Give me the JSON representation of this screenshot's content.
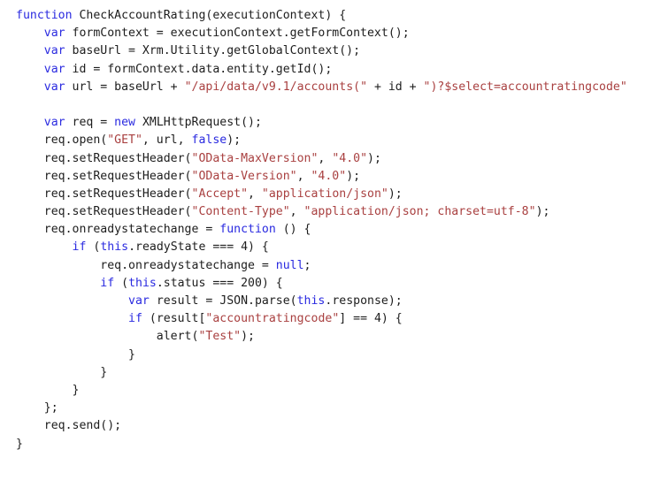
{
  "editor": {
    "language": "javascript",
    "background_color": "#ffffff",
    "default_text_color": "#1d1d1d",
    "keyword_color": "#2a2ae0",
    "string_color": "#a94040",
    "font_size_px": 13.2,
    "line_height_px": 20.2
  },
  "code": {
    "lines": [
      {
        "index": 1,
        "indent": 0,
        "text": "function CheckAccountRating(executionContext) {",
        "tokens": [
          {
            "t": "function",
            "c": "tok-keyword"
          },
          {
            "t": " CheckAccountRating(executionContext) {",
            "c": "tok-plain"
          }
        ]
      },
      {
        "index": 2,
        "indent": 4,
        "text": "    var formContext = executionContext.getFormContext();",
        "tokens": [
          {
            "t": "    ",
            "c": "tok-plain"
          },
          {
            "t": "var",
            "c": "tok-keyword"
          },
          {
            "t": " formContext = executionContext.getFormContext();",
            "c": "tok-plain"
          }
        ]
      },
      {
        "index": 3,
        "indent": 4,
        "text": "    var baseUrl = Xrm.Utility.getGlobalContext();",
        "tokens": [
          {
            "t": "    ",
            "c": "tok-plain"
          },
          {
            "t": "var",
            "c": "tok-keyword"
          },
          {
            "t": " baseUrl = Xrm.Utility.getGlobalContext();",
            "c": "tok-plain"
          }
        ]
      },
      {
        "index": 4,
        "indent": 4,
        "text": "    var id = formContext.data.entity.getId();",
        "tokens": [
          {
            "t": "    ",
            "c": "tok-plain"
          },
          {
            "t": "var",
            "c": "tok-keyword"
          },
          {
            "t": " id = formContext.data.entity.getId();",
            "c": "tok-plain"
          }
        ]
      },
      {
        "index": 5,
        "indent": 4,
        "text": "    var url = baseUrl + \"/api/data/v9.1/accounts(\" + id + \")?$select=accountratingcode\"",
        "tokens": [
          {
            "t": "    ",
            "c": "tok-plain"
          },
          {
            "t": "var",
            "c": "tok-keyword"
          },
          {
            "t": " url = baseUrl + ",
            "c": "tok-plain"
          },
          {
            "t": "\"/api/data/v9.1/accounts(\"",
            "c": "tok-string"
          },
          {
            "t": " + id + ",
            "c": "tok-plain"
          },
          {
            "t": "\")?$select=accountratingcode\"",
            "c": "tok-string"
          }
        ]
      },
      {
        "index": 6,
        "indent": 0,
        "text": "",
        "tokens": []
      },
      {
        "index": 7,
        "indent": 4,
        "text": "    var req = new XMLHttpRequest();",
        "tokens": [
          {
            "t": "    ",
            "c": "tok-plain"
          },
          {
            "t": "var",
            "c": "tok-keyword"
          },
          {
            "t": " req = ",
            "c": "tok-plain"
          },
          {
            "t": "new",
            "c": "tok-keyword"
          },
          {
            "t": " XMLHttpRequest();",
            "c": "tok-plain"
          }
        ]
      },
      {
        "index": 8,
        "indent": 4,
        "text": "    req.open(\"GET\", url, false);",
        "tokens": [
          {
            "t": "    req.open(",
            "c": "tok-plain"
          },
          {
            "t": "\"GET\"",
            "c": "tok-string"
          },
          {
            "t": ", url, ",
            "c": "tok-plain"
          },
          {
            "t": "false",
            "c": "tok-keyword"
          },
          {
            "t": ");",
            "c": "tok-plain"
          }
        ]
      },
      {
        "index": 9,
        "indent": 4,
        "text": "    req.setRequestHeader(\"OData-MaxVersion\", \"4.0\");",
        "tokens": [
          {
            "t": "    req.setRequestHeader(",
            "c": "tok-plain"
          },
          {
            "t": "\"OData-MaxVersion\"",
            "c": "tok-string"
          },
          {
            "t": ", ",
            "c": "tok-plain"
          },
          {
            "t": "\"4.0\"",
            "c": "tok-string"
          },
          {
            "t": ");",
            "c": "tok-plain"
          }
        ]
      },
      {
        "index": 10,
        "indent": 4,
        "text": "    req.setRequestHeader(\"OData-Version\", \"4.0\");",
        "tokens": [
          {
            "t": "    req.setRequestHeader(",
            "c": "tok-plain"
          },
          {
            "t": "\"OData-Version\"",
            "c": "tok-string"
          },
          {
            "t": ", ",
            "c": "tok-plain"
          },
          {
            "t": "\"4.0\"",
            "c": "tok-string"
          },
          {
            "t": ");",
            "c": "tok-plain"
          }
        ]
      },
      {
        "index": 11,
        "indent": 4,
        "text": "    req.setRequestHeader(\"Accept\", \"application/json\");",
        "tokens": [
          {
            "t": "    req.setRequestHeader(",
            "c": "tok-plain"
          },
          {
            "t": "\"Accept\"",
            "c": "tok-string"
          },
          {
            "t": ", ",
            "c": "tok-plain"
          },
          {
            "t": "\"application/json\"",
            "c": "tok-string"
          },
          {
            "t": ");",
            "c": "tok-plain"
          }
        ]
      },
      {
        "index": 12,
        "indent": 4,
        "text": "    req.setRequestHeader(\"Content-Type\", \"application/json; charset=utf-8\");",
        "tokens": [
          {
            "t": "    req.setRequestHeader(",
            "c": "tok-plain"
          },
          {
            "t": "\"Content-Type\"",
            "c": "tok-string"
          },
          {
            "t": ", ",
            "c": "tok-plain"
          },
          {
            "t": "\"application/json; charset=utf-8\"",
            "c": "tok-string"
          },
          {
            "t": ");",
            "c": "tok-plain"
          }
        ]
      },
      {
        "index": 13,
        "indent": 4,
        "text": "    req.onreadystatechange = function () {",
        "tokens": [
          {
            "t": "    req.onreadystatechange = ",
            "c": "tok-plain"
          },
          {
            "t": "function",
            "c": "tok-keyword"
          },
          {
            "t": " () {",
            "c": "tok-plain"
          }
        ]
      },
      {
        "index": 14,
        "indent": 8,
        "text": "        if (this.readyState === 4) {",
        "tokens": [
          {
            "t": "        ",
            "c": "tok-plain"
          },
          {
            "t": "if",
            "c": "tok-keyword"
          },
          {
            "t": " (",
            "c": "tok-plain"
          },
          {
            "t": "this",
            "c": "tok-keyword"
          },
          {
            "t": ".readyState === 4) {",
            "c": "tok-plain"
          }
        ]
      },
      {
        "index": 15,
        "indent": 12,
        "text": "            req.onreadystatechange = null;",
        "tokens": [
          {
            "t": "            req.onreadystatechange = ",
            "c": "tok-plain"
          },
          {
            "t": "null",
            "c": "tok-keyword"
          },
          {
            "t": ";",
            "c": "tok-plain"
          }
        ]
      },
      {
        "index": 16,
        "indent": 12,
        "text": "            if (this.status === 200) {",
        "tokens": [
          {
            "t": "            ",
            "c": "tok-plain"
          },
          {
            "t": "if",
            "c": "tok-keyword"
          },
          {
            "t": " (",
            "c": "tok-plain"
          },
          {
            "t": "this",
            "c": "tok-keyword"
          },
          {
            "t": ".status === 200) {",
            "c": "tok-plain"
          }
        ]
      },
      {
        "index": 17,
        "indent": 16,
        "text": "                var result = JSON.parse(this.response);",
        "tokens": [
          {
            "t": "                ",
            "c": "tok-plain"
          },
          {
            "t": "var",
            "c": "tok-keyword"
          },
          {
            "t": " result = JSON.parse(",
            "c": "tok-plain"
          },
          {
            "t": "this",
            "c": "tok-keyword"
          },
          {
            "t": ".response);",
            "c": "tok-plain"
          }
        ]
      },
      {
        "index": 18,
        "indent": 16,
        "text": "                if (result[\"accountratingcode\"] == 4) {",
        "tokens": [
          {
            "t": "                ",
            "c": "tok-plain"
          },
          {
            "t": "if",
            "c": "tok-keyword"
          },
          {
            "t": " (result[",
            "c": "tok-plain"
          },
          {
            "t": "\"accountratingcode\"",
            "c": "tok-string"
          },
          {
            "t": "] == 4) {",
            "c": "tok-plain"
          }
        ]
      },
      {
        "index": 19,
        "indent": 20,
        "text": "                    alert(\"Test\");",
        "tokens": [
          {
            "t": "                    alert(",
            "c": "tok-plain"
          },
          {
            "t": "\"Test\"",
            "c": "tok-string"
          },
          {
            "t": ");",
            "c": "tok-plain"
          }
        ]
      },
      {
        "index": 20,
        "indent": 16,
        "text": "                }",
        "tokens": [
          {
            "t": "                }",
            "c": "tok-plain"
          }
        ]
      },
      {
        "index": 21,
        "indent": 12,
        "text": "            }",
        "tokens": [
          {
            "t": "            }",
            "c": "tok-plain"
          }
        ]
      },
      {
        "index": 22,
        "indent": 8,
        "text": "        }",
        "tokens": [
          {
            "t": "        }",
            "c": "tok-plain"
          }
        ]
      },
      {
        "index": 23,
        "indent": 4,
        "text": "    };",
        "tokens": [
          {
            "t": "    };",
            "c": "tok-plain"
          }
        ]
      },
      {
        "index": 24,
        "indent": 4,
        "text": "    req.send();",
        "tokens": [
          {
            "t": "    req.send();",
            "c": "tok-plain"
          }
        ]
      },
      {
        "index": 25,
        "indent": 0,
        "text": "}",
        "tokens": [
          {
            "t": "}",
            "c": "tok-plain"
          }
        ]
      }
    ]
  }
}
